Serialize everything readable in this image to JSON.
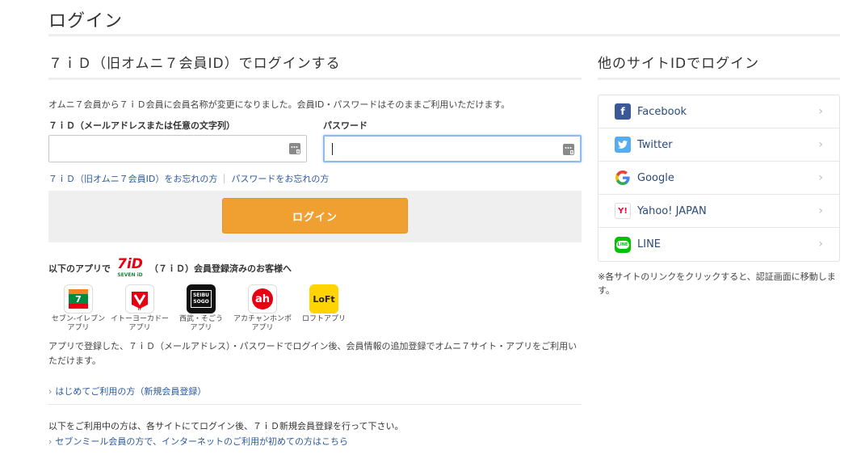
{
  "page": {
    "title": "ログイン"
  },
  "login": {
    "section_title": "７ｉＤ（旧オムニ７会員ID）でログインする",
    "notice": "オムニ７会員から７ｉＤ会員に会員名称が変更になりました。会員ID・パスワードはそのままご利用いただけます。",
    "id_label": "７ｉＤ（メールアドレスまたは任意の文字列）",
    "id_value": "",
    "password_label": "パスワード",
    "password_value": "",
    "forgot_id": "７ｉＤ（旧オムニ７会員ID）をお忘れの方",
    "forgot_password": "パスワードをお忘れの方",
    "login_button": "ログイン"
  },
  "apps": {
    "head_prefix": "以下のアプリで",
    "head_suffix": "（７ｉＤ）会員登録済みのお客様へ",
    "logo_text": "7iD",
    "logo_subtext": "SEVEN iD",
    "items": [
      {
        "label": "セブン-イレブン\nアプリ",
        "icon": "seven-eleven-icon",
        "badge": "7"
      },
      {
        "label": "イトーヨーカドー\nアプリ",
        "icon": "itoyokado-icon",
        "badge": "IY"
      },
      {
        "label": "西武・そごう\nアプリ",
        "icon": "seibu-sogo-icon",
        "badge": "SEIBU SOGO"
      },
      {
        "label": "アカチャンホンポ\nアプリ",
        "icon": "akachan-honpo-icon",
        "badge": "ah"
      },
      {
        "label": "ロフトアプリ",
        "icon": "loft-icon",
        "badge": "LoFt"
      }
    ],
    "description": "アプリで登録した、７ｉＤ（メールアドレス）・パスワードでログイン後、会員情報の追加登録でオムニ７サイト・アプリをご利用いただけます。",
    "first_time_link": "はじめてご利用の方（新規会員登録）"
  },
  "other": {
    "note": "以下をご利用中の方は、各サイトにてログイン後、７ｉＤ新規会員登録を行って下さい。",
    "meal_link": "セブンミール会員の方で、インターネットのご利用が初めての方はこちら"
  },
  "social": {
    "title": "他のサイトIDでログイン",
    "items": [
      {
        "label": "Facebook",
        "icon": "facebook-icon",
        "color": "#3b5998",
        "glyph": "f"
      },
      {
        "label": "Twitter",
        "icon": "twitter-icon",
        "color": "#55acee",
        "glyph": "t"
      },
      {
        "label": "Google",
        "icon": "google-icon",
        "color": "#ffffff",
        "glyph": "G"
      },
      {
        "label": "Yahoo! JAPAN",
        "icon": "yahoo-icon",
        "color": "#ff0033",
        "glyph": "Y!"
      },
      {
        "label": "LINE",
        "icon": "line-icon",
        "color": "#00c300",
        "glyph": "LINE"
      }
    ],
    "note": "※各サイトのリンクをクリックすると、認証画面に移動します。"
  },
  "colors": {
    "accent_orange": "#f0a030",
    "link_blue": "#2b5a9e"
  }
}
